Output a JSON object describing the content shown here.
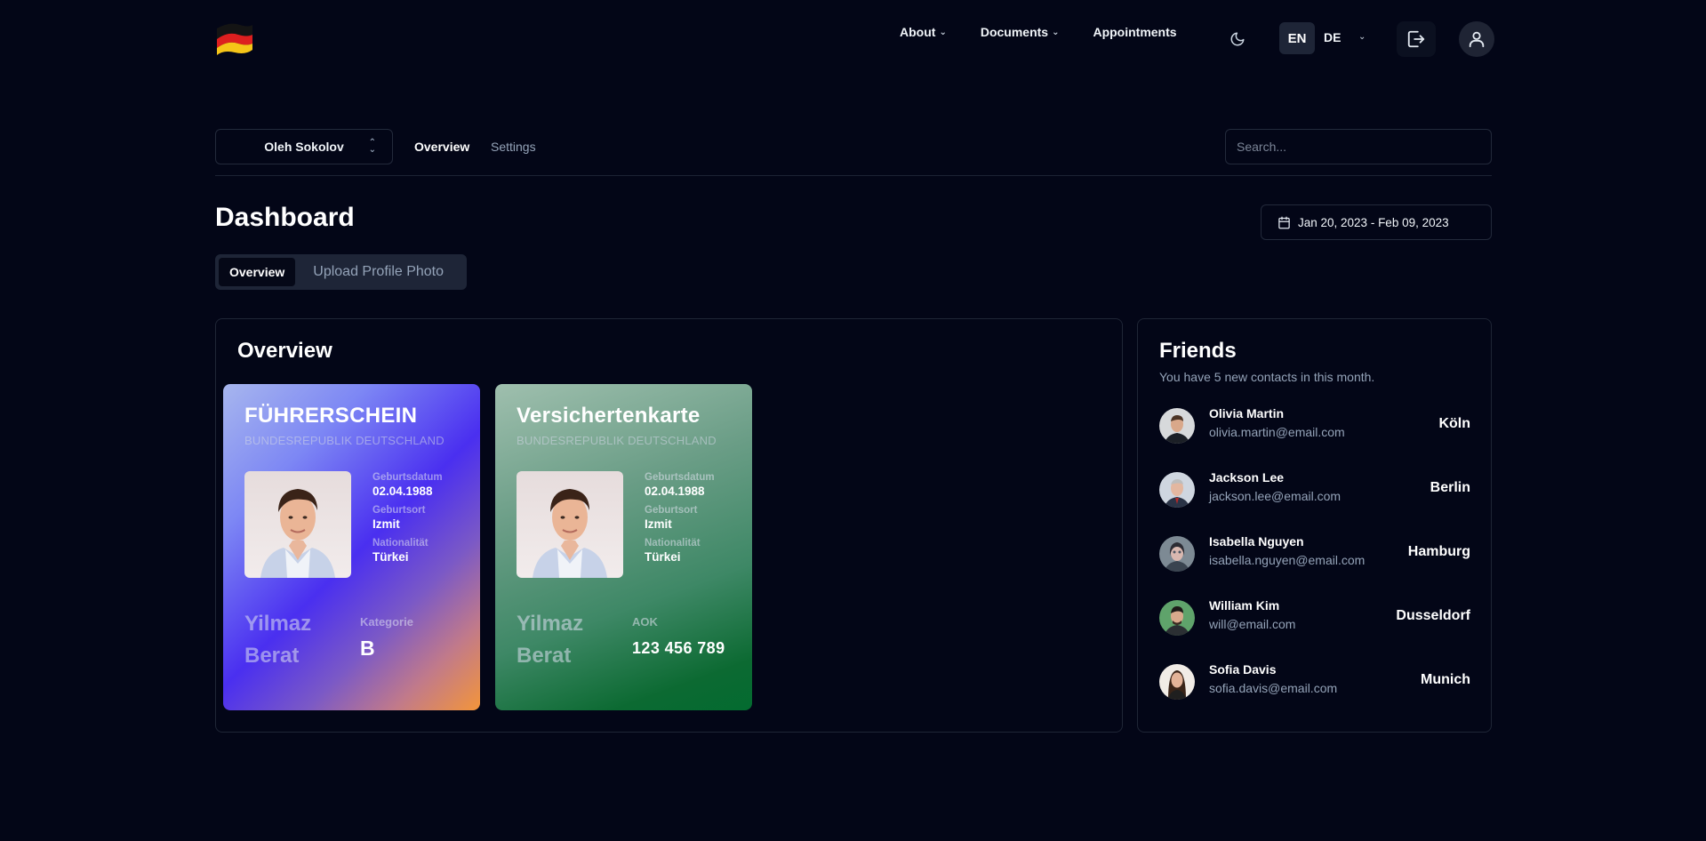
{
  "nav": {
    "links": [
      {
        "label": "About",
        "has_menu": true
      },
      {
        "label": "Documents",
        "has_menu": true
      },
      {
        "label": "Appointments",
        "has_menu": false
      }
    ],
    "lang_active": "EN",
    "lang_other": "DE",
    "icons": [
      "germany-flag-logo",
      "moon-icon",
      "logout-icon",
      "user-icon"
    ]
  },
  "subheader": {
    "account": "Oleh Sokolov",
    "tabs": [
      "Overview",
      "Settings"
    ],
    "search_placeholder": "Search..."
  },
  "dashboard": {
    "title": "Dashboard",
    "date_range": "Jan 20, 2023 - Feb 09, 2023",
    "tabs": [
      "Overview",
      "Upload Profile Photo"
    ]
  },
  "overview": {
    "title": "Overview",
    "cards": [
      {
        "title": "FÜHRERSCHEIN",
        "subtitle": "BUNDESREPUBLIK DEUTSCHLAND",
        "fields": [
          {
            "label": "Geburtsdatum",
            "value": "02.04.1988"
          },
          {
            "label": "Geburtsort",
            "value": "Izmit"
          },
          {
            "label": "Nationalität",
            "value": "Türkei"
          }
        ],
        "surname": "Yilmaz",
        "given_name": "Berat",
        "extra_label": "Kategorie",
        "extra_value": "B"
      },
      {
        "title": "Versichertenkarte",
        "subtitle": "BUNDESREPUBLIK DEUTSCHLAND",
        "fields": [
          {
            "label": "Geburtsdatum",
            "value": "02.04.1988"
          },
          {
            "label": "Geburtsort",
            "value": "Izmit"
          },
          {
            "label": "Nationalität",
            "value": "Türkei"
          }
        ],
        "surname": "Yilmaz",
        "given_name": "Berat",
        "extra_label": "AOK",
        "extra_value": "123 456 789"
      }
    ]
  },
  "friends": {
    "title": "Friends",
    "subtitle": "You have 5 new contacts in this month.",
    "items": [
      {
        "name": "Olivia Martin",
        "email": "olivia.martin@email.com",
        "city": "Köln"
      },
      {
        "name": "Jackson Lee",
        "email": "jackson.lee@email.com",
        "city": "Berlin"
      },
      {
        "name": "Isabella Nguyen",
        "email": "isabella.nguyen@email.com",
        "city": "Hamburg"
      },
      {
        "name": "William Kim",
        "email": "will@email.com",
        "city": "Dusseldorf"
      },
      {
        "name": "Sofia Davis",
        "email": "sofia.davis@email.com",
        "city": "Munich"
      }
    ]
  },
  "colors": {
    "background": "#030617",
    "panel_border": "#1f2636",
    "muted_text": "#94a3b8",
    "license_gradient": [
      "#a7b6ee",
      "#4a2ff0",
      "#f3953a"
    ],
    "insurance_gradient": [
      "#9fbfae",
      "#3e8866",
      "#036b30"
    ]
  }
}
